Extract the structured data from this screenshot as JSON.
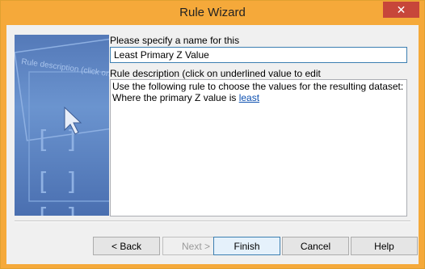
{
  "window": {
    "title": "Rule Wizard",
    "close_glyph": "✕"
  },
  "side_image": {
    "caption": "Rule description (click on"
  },
  "name_section": {
    "label": "Please specify a name for this",
    "value": "Least Primary Z Value"
  },
  "description_section": {
    "label": "Rule description (click on underlined value to edit",
    "line1": "Use the following rule to choose the values for the resulting dataset:",
    "line2_prefix": "Where the primary Z value is ",
    "line2_link": "least"
  },
  "buttons": {
    "back": "< Back",
    "next": "Next >",
    "finish": "Finish",
    "cancel": "Cancel",
    "help": "Help"
  },
  "colors": {
    "accent": "#f5a93a",
    "close": "#c7463a",
    "link": "#0b4fb0"
  }
}
